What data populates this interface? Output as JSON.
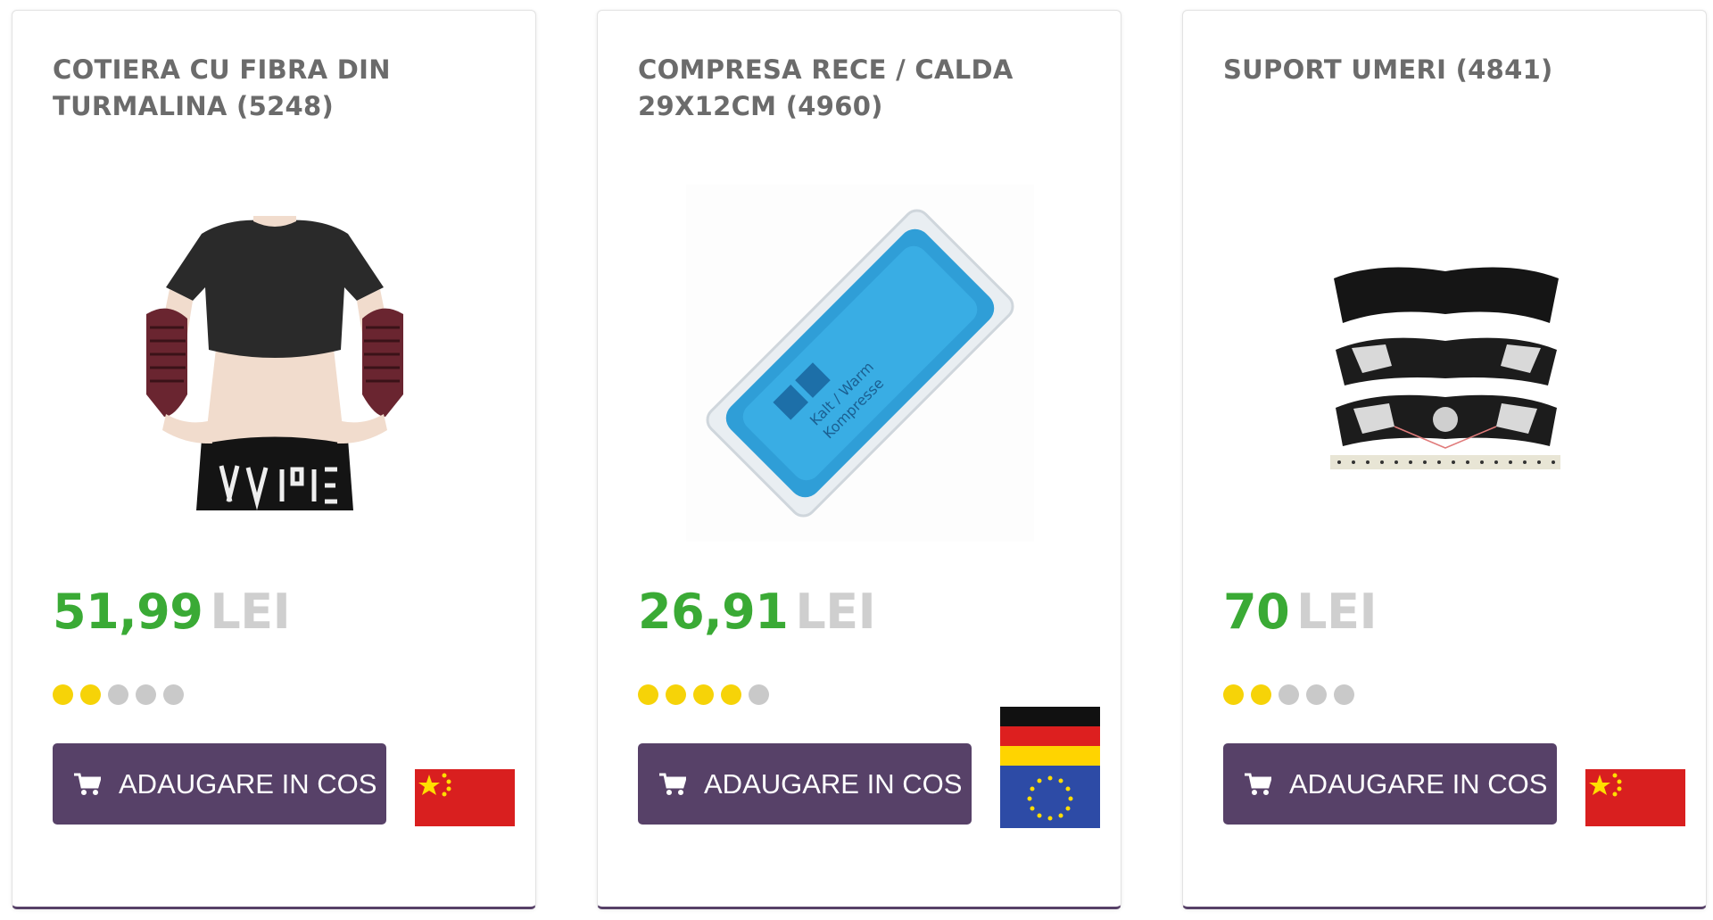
{
  "products": [
    {
      "title": "COTIERA CU FIBRA DIN TURMALINA (5248)",
      "price": "51,99",
      "currency": "LEI",
      "rating": 2,
      "rating_max": 5,
      "button_label": "ADAUGARE IN COS",
      "button_icon": "cart-icon",
      "origin_flag": "china-flag",
      "image": "elbow-support-photo"
    },
    {
      "title": "COMPRESA RECE / CALDA 29X12CM (4960)",
      "price": "26,91",
      "currency": "LEI",
      "rating": 4,
      "rating_max": 5,
      "button_label": "ADAUGARE IN COS",
      "button_icon": "cart-icon",
      "origin_flag": "germany-eu-flag",
      "image": "cold-hot-compress-photo",
      "image_text": [
        "Kalt / Warm",
        "Kompresse"
      ]
    },
    {
      "title": "SUPORT UMERI (4841)",
      "price": "70",
      "currency": "LEI",
      "rating": 2,
      "rating_max": 5,
      "button_label": "ADAUGARE IN COS",
      "button_icon": "cart-icon",
      "origin_flag": "china-flag",
      "image": "shoulder-support-photo"
    }
  ],
  "colors": {
    "price": "#3aaa35",
    "currency": "#cfcfcf",
    "button": "#574168",
    "star_on": "#f6d308",
    "star_off": "#c9c9c9"
  }
}
